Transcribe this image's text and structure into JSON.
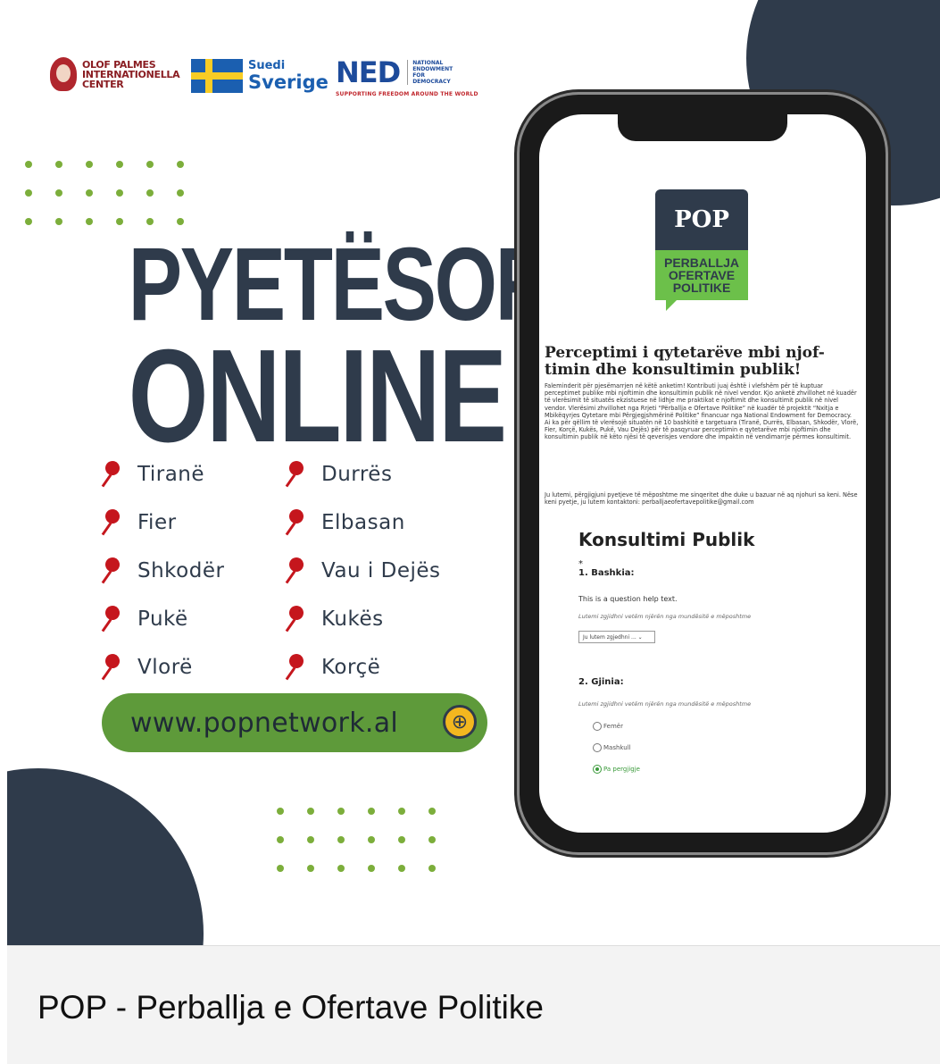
{
  "logos": {
    "olof_palme": "OLOF PALMES\nINTERNATIONELLA\nCENTER",
    "sweden_line1": "Suedi",
    "sweden_line2": "Sverige",
    "ned_word": "NED",
    "ned_full": "NATIONAL\nENDOWMENT\nFOR\nDEMOCRACY",
    "ned_tagline": "SUPPORTING FREEDOM AROUND THE WORLD"
  },
  "headline": {
    "line1": "PYETËSOR",
    "line2": "ONLINE"
  },
  "cities": [
    "Tiranë",
    "Durrës",
    "Fier",
    "Elbasan",
    "Shkodër",
    "Vau i Dejës",
    "Pukë",
    "Kukës",
    "Vlorë",
    "Korçë"
  ],
  "website": "www.popnetwork.al",
  "phone": {
    "logo_top": "POP",
    "logo_line1": "PERBALLJA",
    "logo_line2": "OFERTAVE",
    "logo_line3": "POLITIKE",
    "form_title": "Perceptimi i qytetarëve mbi njof-timin dhe konsultimin publik!",
    "form_desc": "Faleminderit për pjesëmarrjen në këtë anketim! Kontributi juaj është i vlefshëm për të kuptuar perceptimet publike mbi njoftimin dhe konsultimin publik në nivel vendor. Kjo anketë zhvillohet në kuadër të vlerësimit të situatës ekzistuese në lidhje me praktikat e njoftimit dhe konsultimit publik në nivel vendor. Vlerësimi zhvillohet nga Rrjeti “Përballja e Ofertave Politike” në kuadër të projektit “Nxitja e Mbikëqyrjes Qytetare mbi Përgjegjshmërinë Politike” financuar nga National Endowment for Democracy. Ai ka për qëllim të vlerësojë situatën në 10 bashkitë e targetuara (Tiranë, Durrës, Elbasan, Shkodër, Vlorë, Fier, Korçë, Kukës, Pukë, Vau Dejës) për të pasqyruar perceptimin e qytetarëve mbi njoftimin dhe konsultimin publik në këto njësi të qeverisjes vendore dhe impaktin në vendimarrje përmes konsultimit.",
    "form_contact": "Ju lutemi, përgjigjuni pyetjeve të mëposhtme me sinqeritet dhe duke u bazuar në aq njohuri sa keni. Nëse keni pyetje, ju lutem kontaktoni: perballjaeofertavepolitike@gmail.com",
    "section_title": "Konsultimi Publik",
    "asterisk": "*",
    "q1_label": "1. Bashkia:",
    "q1_help": "This is a question help text.",
    "q1_hint": "Lutemi zgjidhni vetëm njërën nga mundësitë e mëposhtme",
    "q1_select": "Ju lutem zgjedhni ...  ⌄",
    "q2_label": "2. Gjinia:",
    "q2_hint": "Lutemi zgjidhni vetëm njërën nga mundësitë e mëposhtme",
    "q2_options": [
      "Femër",
      "Mashkull",
      "Pa pergjigje"
    ],
    "q2_selected": "Pa pergjigje"
  },
  "footer_title": "POP - Perballja e Ofertave Politike",
  "colors": {
    "navy": "#2f3b4b",
    "green": "#7cae3b",
    "pin_red": "#c5161d",
    "pill_green": "#5e9a3a"
  }
}
